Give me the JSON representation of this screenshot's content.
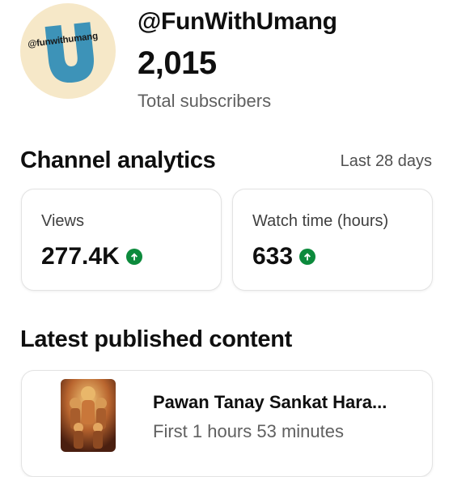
{
  "channel": {
    "avatar_text": "@funwithumang",
    "handle": "@FunWithUmang",
    "subscriber_count": "2,015",
    "subscriber_label": "Total subscribers"
  },
  "analytics": {
    "title": "Channel analytics",
    "period": "Last 28 days",
    "cards": [
      {
        "label": "Views",
        "value": "277.4K",
        "trend_icon": "arrow-up-icon"
      },
      {
        "label": "Watch time (hours)",
        "value": "633",
        "trend_icon": "arrow-up-icon"
      }
    ]
  },
  "latest": {
    "title": "Latest published content",
    "video": {
      "title": "Pawan Tanay Sankat Hara...",
      "subtitle": "First 1 hours 53 minutes"
    }
  },
  "colors": {
    "trend_up": "#0c8a3c",
    "avatar_bg": "#f6e8c8",
    "avatar_accent": "#3d93b8"
  }
}
